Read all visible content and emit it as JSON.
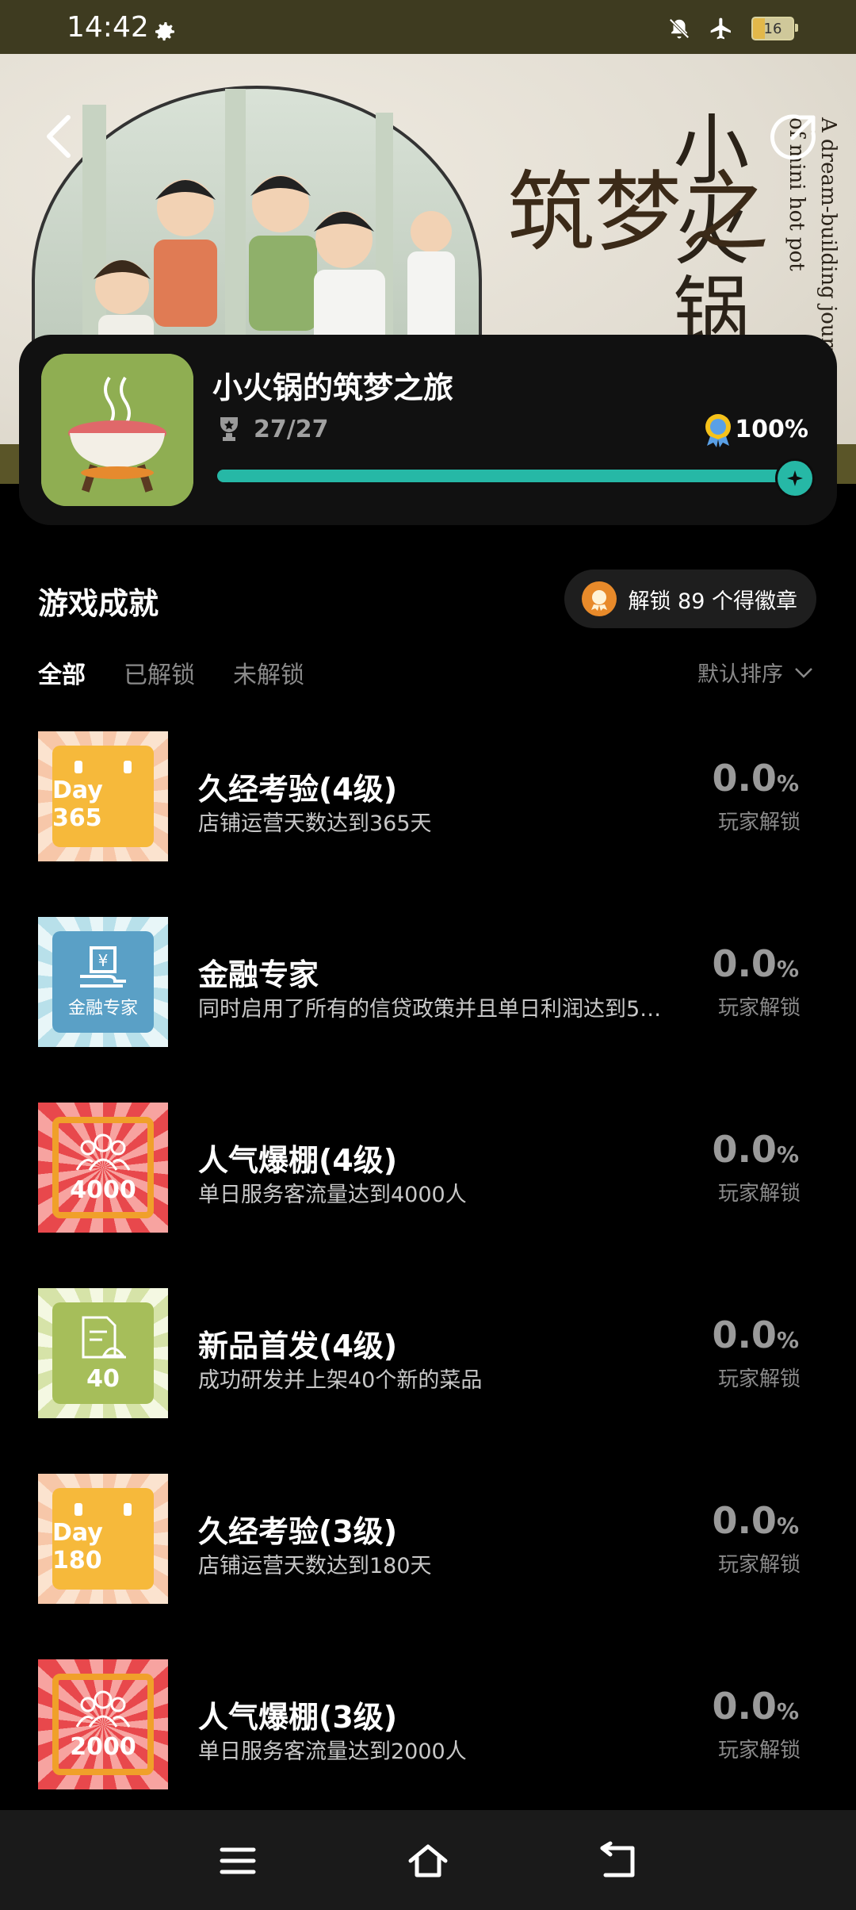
{
  "status": {
    "time": "14:42",
    "battery": "16"
  },
  "banner": {
    "calligraphy_title": "小火锅",
    "calligraphy_sub": "筑梦之",
    "english_1": "A dream-building journey",
    "english_2": "of mini hot pot"
  },
  "game": {
    "title": "小火锅的筑梦之旅",
    "trophy_count": "27/27",
    "percent": "100%",
    "progress": 1.0
  },
  "section": {
    "title": "游戏成就",
    "badge_text": "解锁 89 个得徽章"
  },
  "tabs": [
    "全部",
    "已解锁",
    "未解锁"
  ],
  "sort_label": "默认排序",
  "achievements": [
    {
      "name": "久经考验(4级)",
      "desc": "店铺运营天数达到365天",
      "pct": "0.0",
      "unit": "%",
      "unlock": "玩家解锁",
      "icon_text": "Day 365",
      "style": "calendar"
    },
    {
      "name": "金融专家",
      "desc": "同时启用了所有的信贷政策并且单日利润达到5…",
      "pct": "0.0",
      "unit": "%",
      "unlock": "玩家解锁",
      "icon_text": "金融专家",
      "style": "finance"
    },
    {
      "name": "人气爆棚(4级)",
      "desc": "单日服务客流量达到4000人",
      "pct": "0.0",
      "unit": "%",
      "unlock": "玩家解锁",
      "icon_text": "4000",
      "style": "people"
    },
    {
      "name": "新品首发(4级)",
      "desc": "成功研发并上架40个新的菜品",
      "pct": "0.0",
      "unit": "%",
      "unlock": "玩家解锁",
      "icon_text": "40",
      "style": "newdish"
    },
    {
      "name": "久经考验(3级)",
      "desc": "店铺运营天数达到180天",
      "pct": "0.0",
      "unit": "%",
      "unlock": "玩家解锁",
      "icon_text": "Day 180",
      "style": "calendar"
    },
    {
      "name": "人气爆棚(3级)",
      "desc": "单日服务客流量达到2000人",
      "pct": "0.0",
      "unit": "%",
      "unlock": "玩家解锁",
      "icon_text": "2000",
      "style": "people"
    }
  ],
  "colors": {
    "accent": "#26b8a6",
    "calendar": "#f6b93b",
    "finance": "#5aa0c6",
    "people": "#f0a02a",
    "newdish": "#a6be5a"
  }
}
